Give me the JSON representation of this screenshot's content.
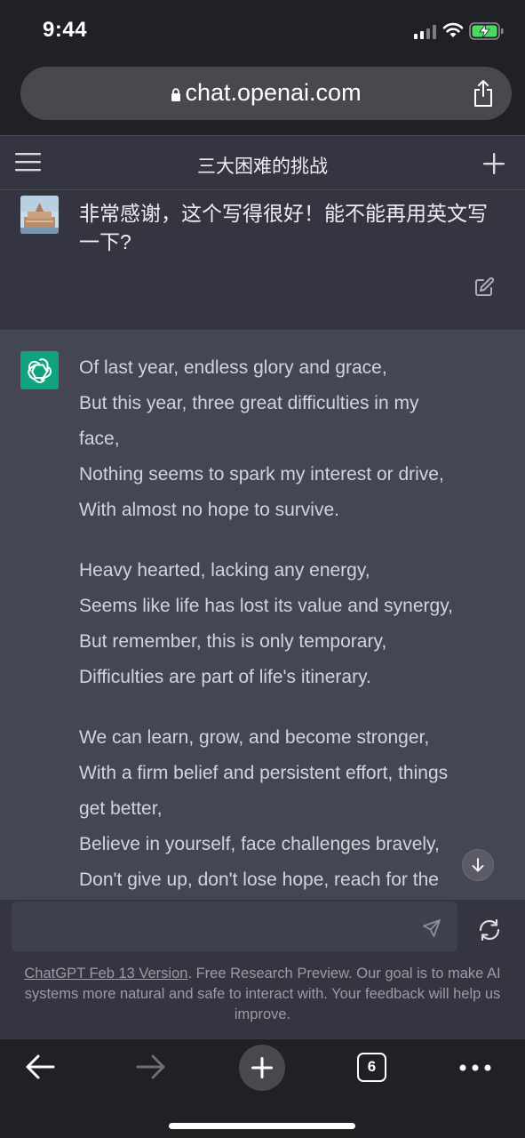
{
  "status_bar": {
    "time": "9:44"
  },
  "browser": {
    "url": "chat.openai.com",
    "tab_count": "6"
  },
  "header": {
    "title": "三大困难的挑战"
  },
  "conversation": {
    "user_message": "非常感谢，这个写得很好！能不能再用英文写一下?",
    "assistant_stanzas": [
      [
        "Of last year, endless glory and grace,",
        "But this year, three great difficulties in my",
        "face,",
        "Nothing seems to spark my interest or drive,",
        "With almost no hope to survive."
      ],
      [
        "Heavy hearted, lacking any energy,",
        "Seems like life has lost its value and synergy,",
        "But remember, this is only temporary,",
        "Difficulties are part of life's itinerary."
      ],
      [
        "We can learn, grow, and become stronger,",
        "With a firm belief and persistent effort, things",
        "get better,",
        "Believe in yourself, face challenges bravely,",
        "Don't give up, don't lose hope, reach for the"
      ]
    ]
  },
  "composer": {
    "placeholder": "",
    "footer_link": "ChatGPT Feb 13 Version",
    "footer_text": ". Free Research Preview. Our goal is to make AI systems more natural and safe to interact with. Your feedback will help us improve."
  },
  "colors": {
    "app_bg": "#343541",
    "assistant_bg": "#444654",
    "brand_green": "#10a37f",
    "browser_chrome": "#202124"
  },
  "icons": {
    "menu": "hamburger-menu-icon",
    "new_chat": "plus-icon",
    "edit": "edit-icon",
    "send": "send-icon",
    "regenerate": "refresh-icon",
    "share": "share-icon"
  }
}
